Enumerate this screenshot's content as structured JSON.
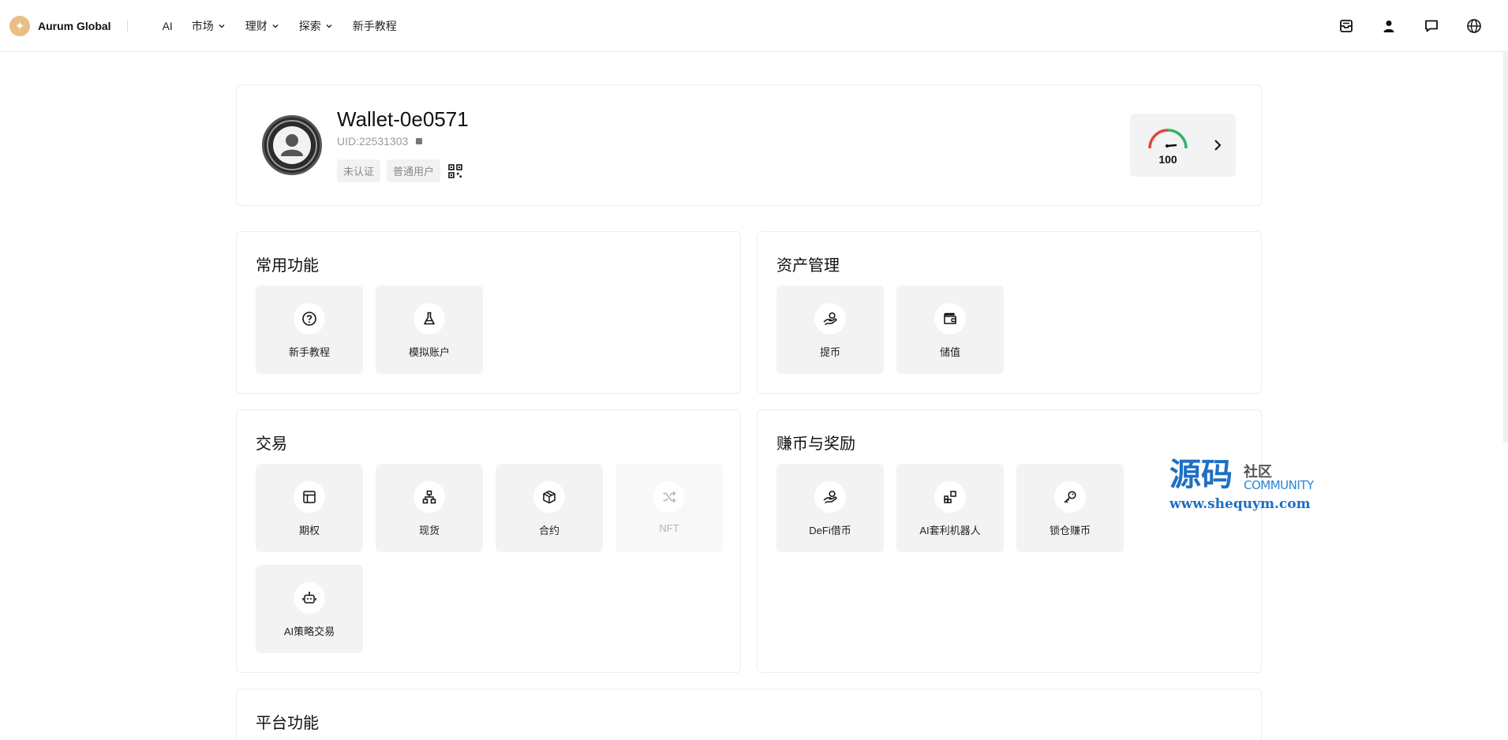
{
  "nav": {
    "brand": "Aurum Global",
    "items": [
      {
        "label": "AI",
        "dropdown": false
      },
      {
        "label": "市场",
        "dropdown": true
      },
      {
        "label": "理财",
        "dropdown": true
      },
      {
        "label": "探索",
        "dropdown": true
      },
      {
        "label": "新手教程",
        "dropdown": false
      }
    ],
    "right_icons": [
      "inbox-icon",
      "user-icon",
      "chat-icon",
      "globe-icon"
    ]
  },
  "profile": {
    "name": "Wallet-0e0571",
    "uid": "UID:22531303",
    "tags": [
      "未认证",
      "普通用户"
    ],
    "score": "100"
  },
  "sections": {
    "common": {
      "title": "常用功能",
      "items": [
        {
          "label": "新手教程",
          "icon": "question-circle-icon"
        },
        {
          "label": "模拟账户",
          "icon": "flask-icon"
        }
      ]
    },
    "assets": {
      "title": "资产管理",
      "items": [
        {
          "label": "提币",
          "icon": "hand-coin-icon"
        },
        {
          "label": "储值",
          "icon": "wallet-icon"
        }
      ]
    },
    "trade": {
      "title": "交易",
      "items": [
        {
          "label": "期权",
          "icon": "layout-icon"
        },
        {
          "label": "现货",
          "icon": "network-icon"
        },
        {
          "label": "合约",
          "icon": "box-icon"
        },
        {
          "label": "NFT",
          "icon": "shuffle-icon",
          "disabled": true
        },
        {
          "label": "AI策略交易",
          "icon": "robot-icon"
        }
      ]
    },
    "earn": {
      "title": "赚币与奖励",
      "items": [
        {
          "label": "DeFi借币",
          "icon": "hand-coin-icon"
        },
        {
          "label": "AI套利机器人",
          "icon": "apps-add-icon"
        },
        {
          "label": "锁仓赚币",
          "icon": "key-icon"
        }
      ]
    },
    "platform": {
      "title": "平台功能"
    }
  },
  "watermark": {
    "big": "源码",
    "small": "社区",
    "en": "COMMUNITY",
    "url": "www.shequym.com"
  },
  "colors": {
    "tile_bg": "#f3f3f3",
    "brand_gold": "#e9bf86",
    "gauge_red": "#e0473e",
    "gauge_green": "#31b46a"
  }
}
